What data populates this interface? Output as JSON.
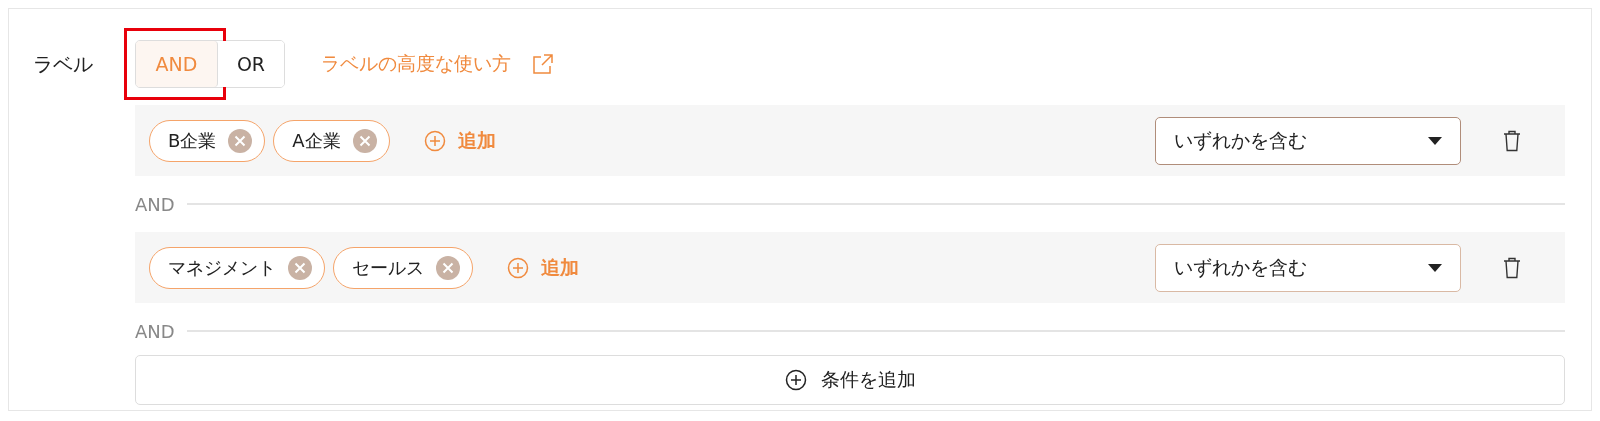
{
  "filter": {
    "label": "ラベル",
    "operator_options": [
      {
        "label": "AND",
        "selected": true,
        "highlighted": true
      },
      {
        "label": "OR",
        "selected": false,
        "highlighted": false
      }
    ],
    "help_link": "ラベルの高度な使い方",
    "conditions": [
      {
        "chips": [
          "B企業",
          "A企業"
        ],
        "add_label": "追加",
        "match": "いずれかを含む",
        "focused": true
      },
      {
        "chips": [
          "マネジメント",
          "セールス"
        ],
        "add_label": "追加",
        "match": "いずれかを含む",
        "focused": false
      }
    ],
    "joiners": [
      "AND",
      "AND"
    ],
    "add_condition": "条件を追加"
  }
}
